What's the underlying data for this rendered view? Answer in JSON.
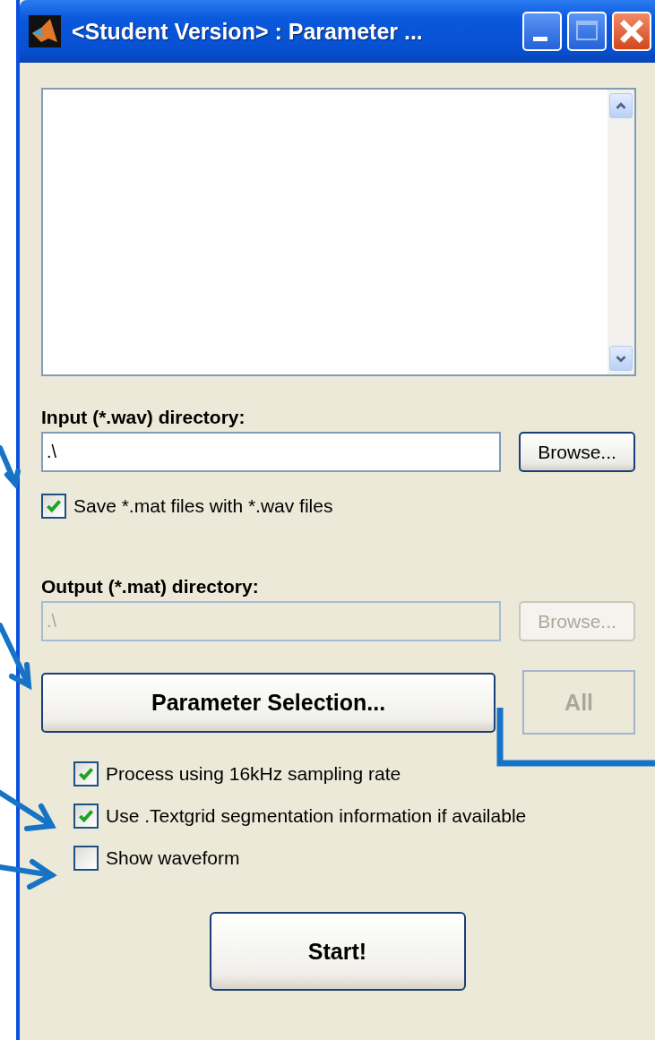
{
  "window": {
    "title": "<Student Version> : Parameter ..."
  },
  "input": {
    "label": "Input (*.wav) directory:",
    "value": ".\\",
    "disabled": false,
    "browse": "Browse..."
  },
  "save_mat": {
    "label": "Save *.mat files with *.wav files",
    "checked": true
  },
  "output": {
    "label": "Output (*.mat) directory:",
    "value": ".\\",
    "disabled": true,
    "browse": "Browse..."
  },
  "parameter_button": {
    "label": "Parameter Selection..."
  },
  "all_button": {
    "label": "All",
    "disabled": true
  },
  "options": [
    {
      "label": "Process using 16kHz sampling rate",
      "checked": true
    },
    {
      "label": "Use .Textgrid segmentation information if available",
      "checked": true
    },
    {
      "label": "Show waveform",
      "checked": false
    }
  ],
  "start_button": {
    "label": "Start!"
  }
}
